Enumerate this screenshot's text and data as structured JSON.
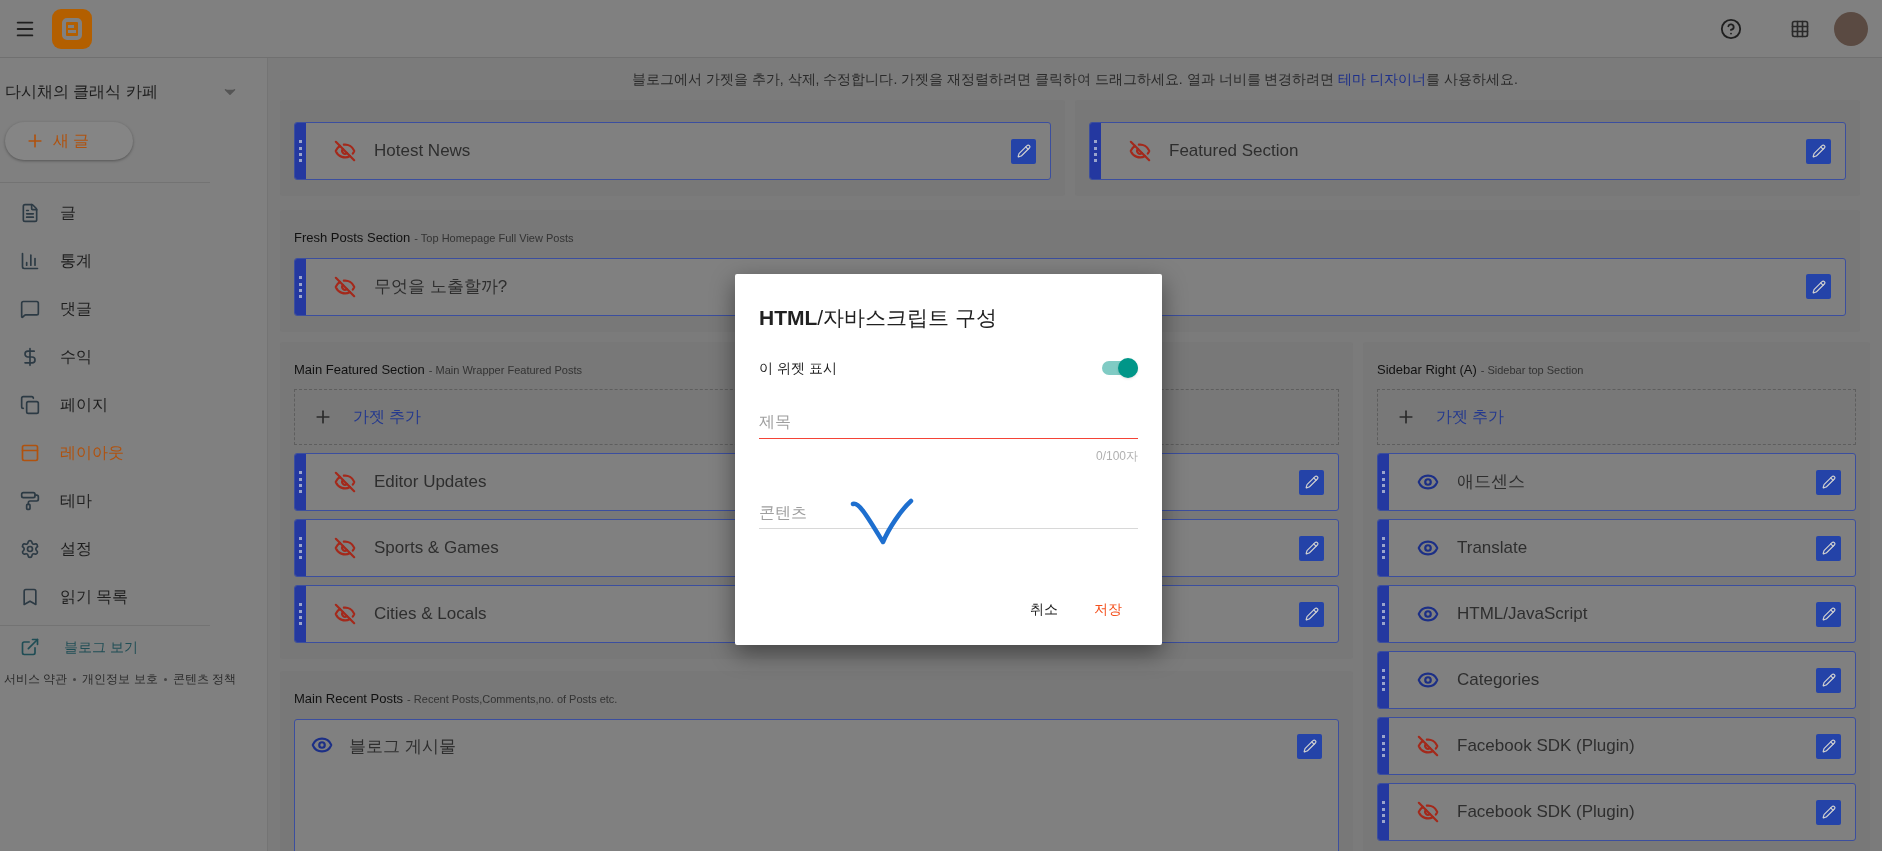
{
  "sidebar": {
    "blog_name": "다시채의 클래식 카페",
    "new_post": "새 글",
    "nav": [
      {
        "label": "글",
        "selected": false
      },
      {
        "label": "통계",
        "selected": false
      },
      {
        "label": "댓글",
        "selected": false
      },
      {
        "label": "수익",
        "selected": false
      },
      {
        "label": "페이지",
        "selected": false
      },
      {
        "label": "레이아웃",
        "selected": true
      },
      {
        "label": "테마",
        "selected": false
      },
      {
        "label": "설정",
        "selected": false
      },
      {
        "label": "읽기 목록",
        "selected": false
      }
    ],
    "view_blog": "블로그 보기",
    "footer_links": [
      "서비스 약관",
      "개인정보 보호",
      "콘텐츠 정책"
    ]
  },
  "info": {
    "text_before": "블로그에서 가젯을 추가, 삭제, 수정합니다. 가젯을 재정렬하려면 클릭하여 드래그하세요. 열과 너비를 변경하려면 ",
    "link": "테마 디자이너",
    "text_after": "를 사용하세요."
  },
  "top_row": [
    {
      "widgets": [
        {
          "kind": "row",
          "label": "Hotest News",
          "visible": false
        }
      ]
    },
    {
      "widgets": [
        {
          "kind": "row",
          "label": "Featured Section",
          "visible": false
        }
      ]
    }
  ],
  "fresh_posts": {
    "title": "Fresh Posts Section",
    "subtitle": "- Top Homepage Full View Posts",
    "widgets": [
      {
        "kind": "row",
        "label": "무엇을 노출할까?",
        "visible": false
      }
    ]
  },
  "main_column": [
    {
      "title": "Main Featured Section",
      "subtitle": "- Main Wrapper Featured Posts",
      "add_gadget": "가젯 추가",
      "widgets": [
        {
          "kind": "row",
          "label": "Editor Updates",
          "visible": false
        },
        {
          "kind": "row",
          "label": "Sports & Games",
          "visible": false
        },
        {
          "kind": "row",
          "label": "Cities & Locals",
          "visible": false
        }
      ]
    },
    {
      "title": "Main Recent Posts",
      "subtitle": "- Recent Posts,Comments,no. of Posts etc.",
      "widgets": [
        {
          "kind": "panel",
          "label": "블로그 게시물",
          "visible": true
        }
      ]
    }
  ],
  "sidebar_column": [
    {
      "title": "Sidebar Right (A)",
      "subtitle": "- Sidebar top Section",
      "add_gadget": "가젯 추가",
      "widgets": [
        {
          "kind": "row",
          "label": "애드센스",
          "visible": true
        },
        {
          "kind": "row",
          "label": "Translate",
          "visible": true
        },
        {
          "kind": "row",
          "label": "HTML/JavaScript",
          "visible": true
        },
        {
          "kind": "row",
          "label": "Categories",
          "visible": true
        },
        {
          "kind": "row",
          "label": "Facebook SDK (Plugin)",
          "visible": false
        },
        {
          "kind": "row",
          "label": "Facebook SDK (Plugin)",
          "visible": false
        }
      ]
    }
  ],
  "dialog": {
    "title": "**HTML**/자바스크립트 구성",
    "show_widget": {
      "label": "이 위젯 표시",
      "on": true
    },
    "title_field": {
      "placeholder": "제목",
      "invalid": true,
      "counter": "0/100자"
    },
    "content_field": {
      "placeholder": "콘텐츠"
    },
    "buttons": [
      {
        "label": "취소",
        "kind": "cancel"
      },
      {
        "label": "저장",
        "kind": "save"
      }
    ]
  }
}
